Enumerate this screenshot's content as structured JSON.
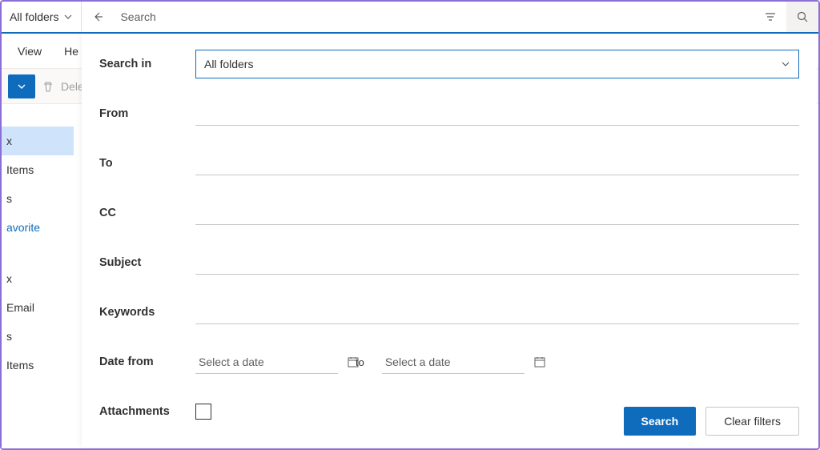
{
  "searchbar": {
    "scope_label": "All folders",
    "placeholder": "Search"
  },
  "toolbar": {
    "view": "View",
    "help": "He"
  },
  "cmdbar": {
    "delete": "Dele"
  },
  "sidebar": {
    "items": [
      "",
      "Items",
      "",
      "avorite",
      "",
      "Email",
      "",
      "Items"
    ],
    "partial_top": "x",
    "partial_mid": "s",
    "partial_mid2": "x",
    "partial_mid3": "s"
  },
  "panel": {
    "labels": {
      "search_in": "Search in",
      "from": "From",
      "to": "To",
      "cc": "CC",
      "subject": "Subject",
      "keywords": "Keywords",
      "date_from": "Date from",
      "date_to": "to",
      "attachments": "Attachments"
    },
    "search_in_value": "All folders",
    "date_placeholder": "Select a date",
    "buttons": {
      "search": "Search",
      "clear": "Clear filters"
    }
  }
}
